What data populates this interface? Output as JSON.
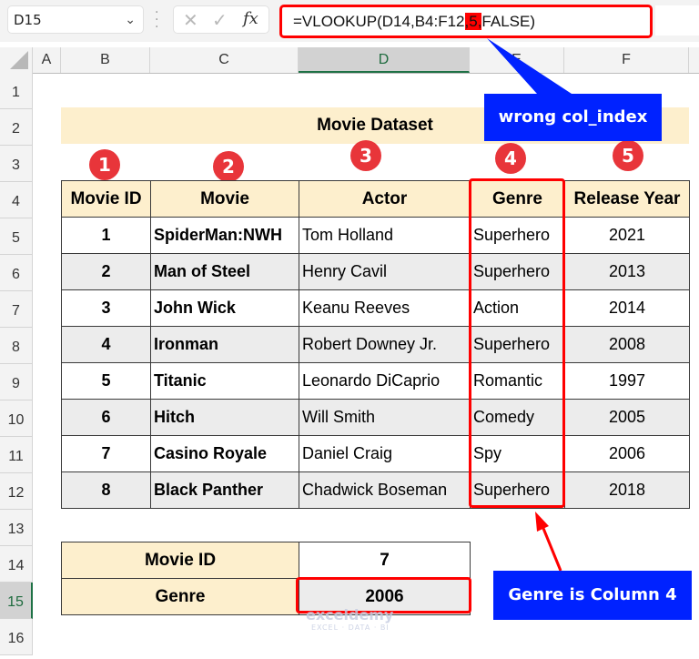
{
  "toolbar": {
    "name_box": "D15",
    "cancel_icon": "✕",
    "enter_icon": "✓",
    "fx_label": "fx",
    "formula_before": "=VLOOKUP(D14,B4:F12",
    "formula_highlight": ",5,",
    "formula_after": "FALSE)"
  },
  "columns": [
    "A",
    "B",
    "C",
    "D",
    "E",
    "F"
  ],
  "selected_column": "D",
  "rows": [
    "1",
    "2",
    "3",
    "4",
    "5",
    "6",
    "7",
    "8",
    "9",
    "10",
    "11",
    "12",
    "13",
    "14",
    "15",
    "16"
  ],
  "selected_row": "15",
  "sheet": {
    "title": "Movie Dataset",
    "badges": [
      "1",
      "2",
      "3",
      "4",
      "5"
    ],
    "headers": [
      "Movie ID",
      "Movie",
      "Actor",
      "Genre",
      "Release Year"
    ],
    "records": [
      {
        "id": "1",
        "movie": "SpiderMan:NWH",
        "actor": "Tom Holland",
        "genre": "Superhero",
        "year": "2021"
      },
      {
        "id": "2",
        "movie": "Man of Steel",
        "actor": "Henry Cavil",
        "genre": "Superhero",
        "year": "2013"
      },
      {
        "id": "3",
        "movie": "John Wick",
        "actor": "Keanu Reeves",
        "genre": "Action",
        "year": "2014"
      },
      {
        "id": "4",
        "movie": "Ironman",
        "actor": "Robert Downey Jr.",
        "genre": "Superhero",
        "year": "2008"
      },
      {
        "id": "5",
        "movie": "Titanic",
        "actor": "Leonardo DiCaprio",
        "genre": "Romantic",
        "year": "1997"
      },
      {
        "id": "6",
        "movie": "Hitch",
        "actor": "Will Smith",
        "genre": "Comedy",
        "year": "2005"
      },
      {
        "id": "7",
        "movie": "Casino Royale",
        "actor": "Daniel Craig",
        "genre": "Spy",
        "year": "2006"
      },
      {
        "id": "8",
        "movie": "Black Panther",
        "actor": "Chadwick Boseman",
        "genre": "Superhero",
        "year": "2018"
      }
    ],
    "lookup": {
      "id_label": "Movie ID",
      "id_value": "7",
      "result_label": "Genre",
      "result_value": "2006"
    }
  },
  "annotations": {
    "callout_top": "wrong col_index",
    "callout_bottom": "Genre is Column 4",
    "highlight_color": "#ff0000",
    "callout_color": "#0022ff"
  },
  "watermark": {
    "brand": "exceldemy",
    "tagline": "EXCEL · DATA · BI"
  }
}
